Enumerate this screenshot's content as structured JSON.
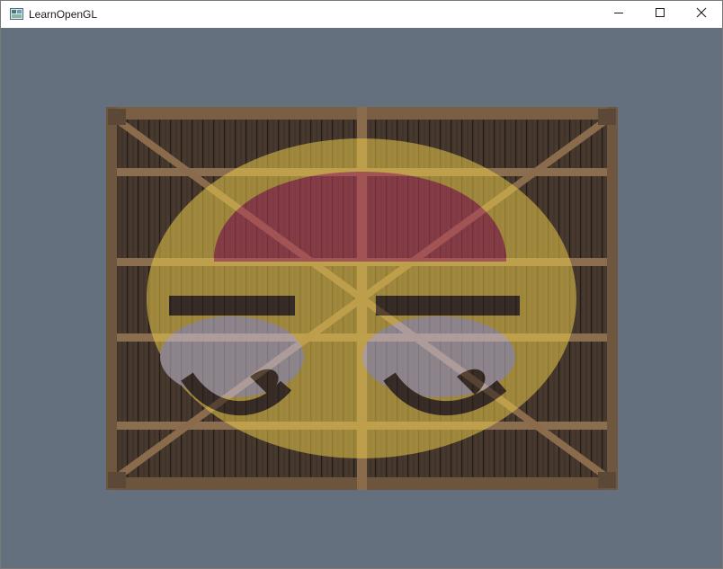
{
  "window": {
    "title": "LearnOpenGL",
    "app_icon": "opengl-app-icon",
    "controls": [
      "minimize-icon",
      "maximize-icon",
      "close-icon"
    ]
  },
  "viewport": {
    "clear_color": "#65707f",
    "scene": {
      "texture_1": "wooden-container",
      "texture_2": "awesomeface",
      "overlay_tint": "#e8c84a"
    }
  }
}
